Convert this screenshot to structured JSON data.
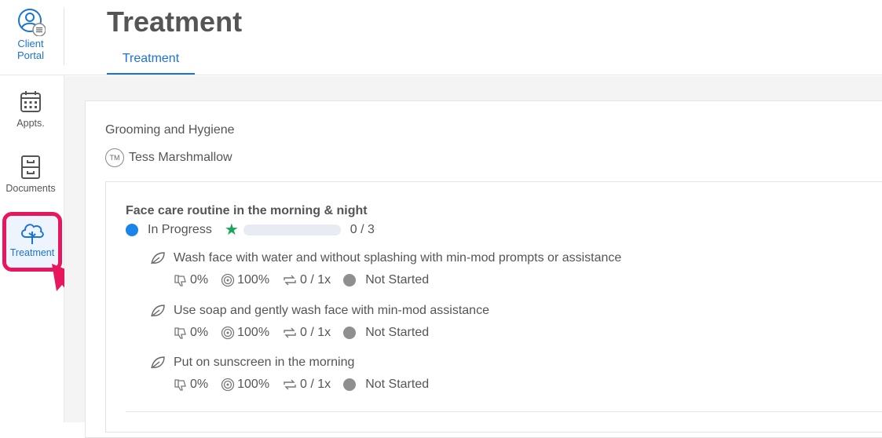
{
  "sidebar": {
    "portal": {
      "line1": "Client",
      "line2": "Portal"
    },
    "items": [
      {
        "label": "Appts.",
        "icon": "calendar-icon"
      },
      {
        "label": "Documents",
        "icon": "file-cabinet-icon"
      },
      {
        "label": "Treatment",
        "icon": "tree-icon"
      }
    ]
  },
  "header": {
    "title": "Treatment",
    "tabs": [
      {
        "label": "Treatment"
      }
    ]
  },
  "goal": {
    "area": "Grooming and Hygiene",
    "owner_initials": "TM",
    "owner_name": "Tess Marshmallow",
    "title": "Face care routine in the morning & night",
    "status": "In Progress",
    "progress_text": "0 / 3",
    "progress_fraction": 0,
    "objectives": [
      {
        "title": "Wash face with water and without splashing with min-mod prompts or assistance",
        "negative": "0%",
        "target": "100%",
        "repeat": "0 / 1x",
        "status": "Not Started"
      },
      {
        "title": "Use soap and gently wash face with min-mod assistance",
        "negative": "0%",
        "target": "100%",
        "repeat": "0 / 1x",
        "status": "Not Started"
      },
      {
        "title": "Put on sunscreen in the morning",
        "negative": "0%",
        "target": "100%",
        "repeat": "0 / 1x",
        "status": "Not Started"
      }
    ]
  },
  "colors": {
    "accent": "#1a73d9",
    "highlight": "#e8175d",
    "status_in_progress": "#1a84e8",
    "status_not_started": "#8f8f8f",
    "star": "#1aa35a"
  }
}
